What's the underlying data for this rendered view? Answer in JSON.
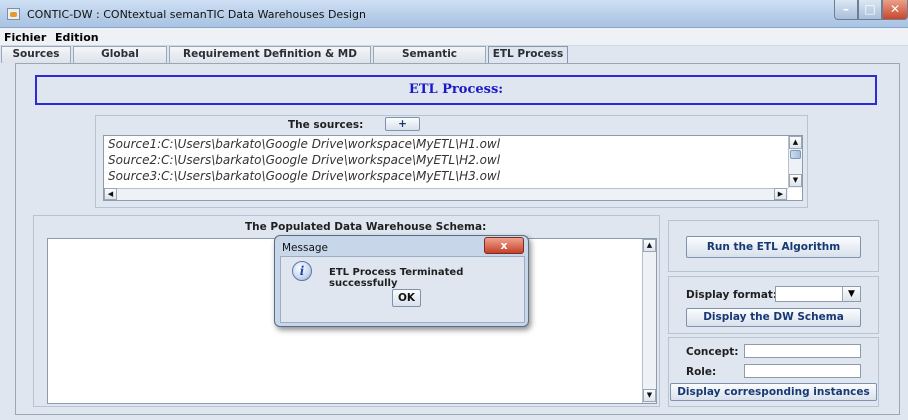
{
  "window": {
    "title": "CONTIC-DW : CONtextual semanTIC Data Warehouses Design",
    "app_icon": "java-cup-icon",
    "controls": {
      "minimize": "–",
      "maximize": "□",
      "close": "✕"
    }
  },
  "menu": {
    "items": [
      "Fichier",
      "Edition"
    ]
  },
  "tabs": [
    {
      "label": "Sources",
      "active": false
    },
    {
      "label": "Global Ontology",
      "active": false
    },
    {
      "label": "Requirement Definition & MD Modeling",
      "active": false
    },
    {
      "label": "Semantic Mappings",
      "active": false
    },
    {
      "label": "ETL Process",
      "active": true
    }
  ],
  "etl": {
    "header": "ETL Process:",
    "sources_label": "The sources:",
    "add_button": "+",
    "sources": [
      "Source1:C:\\Users\\barkato\\Google Drive\\workspace\\MyETL\\H1.owl",
      "Source2:C:\\Users\\barkato\\Google Drive\\workspace\\MyETL\\H2.owl",
      "Source3:C:\\Users\\barkato\\Google Drive\\workspace\\MyETL\\H3.owl"
    ],
    "schema_label": "The Populated Data Warehouse Schema:",
    "schema_text": "",
    "run_button": "Run the ETL Algorithm",
    "display_format_label": "Display format:",
    "display_format_value": "",
    "display_schema_button": "Display the DW Schema",
    "concept_label": "Concept:",
    "concept_value": "",
    "role_label": "Role:",
    "role_value": "",
    "display_instances_button": "Display corresponding instances"
  },
  "dialog": {
    "title": "Message",
    "close": "x",
    "message": "ETL Process Terminated successfully",
    "ok_button": "OK",
    "icon": "info-icon"
  },
  "colors": {
    "accent_blue": "#1919c8",
    "header_border": "#2b2bd8",
    "button_text": "#163873"
  }
}
